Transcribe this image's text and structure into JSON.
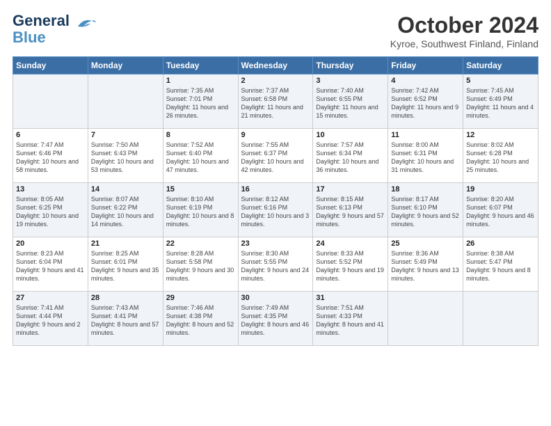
{
  "logo": {
    "line1": "General",
    "line2": "Blue"
  },
  "title": "October 2024",
  "location": "Kyroe, Southwest Finland, Finland",
  "weekdays": [
    "Sunday",
    "Monday",
    "Tuesday",
    "Wednesday",
    "Thursday",
    "Friday",
    "Saturday"
  ],
  "rows": [
    [
      {
        "day": "",
        "sunrise": "",
        "sunset": "",
        "daylight": ""
      },
      {
        "day": "",
        "sunrise": "",
        "sunset": "",
        "daylight": ""
      },
      {
        "day": "1",
        "sunrise": "Sunrise: 7:35 AM",
        "sunset": "Sunset: 7:01 PM",
        "daylight": "Daylight: 11 hours and 26 minutes."
      },
      {
        "day": "2",
        "sunrise": "Sunrise: 7:37 AM",
        "sunset": "Sunset: 6:58 PM",
        "daylight": "Daylight: 11 hours and 21 minutes."
      },
      {
        "day": "3",
        "sunrise": "Sunrise: 7:40 AM",
        "sunset": "Sunset: 6:55 PM",
        "daylight": "Daylight: 11 hours and 15 minutes."
      },
      {
        "day": "4",
        "sunrise": "Sunrise: 7:42 AM",
        "sunset": "Sunset: 6:52 PM",
        "daylight": "Daylight: 11 hours and 9 minutes."
      },
      {
        "day": "5",
        "sunrise": "Sunrise: 7:45 AM",
        "sunset": "Sunset: 6:49 PM",
        "daylight": "Daylight: 11 hours and 4 minutes."
      }
    ],
    [
      {
        "day": "6",
        "sunrise": "Sunrise: 7:47 AM",
        "sunset": "Sunset: 6:46 PM",
        "daylight": "Daylight: 10 hours and 58 minutes."
      },
      {
        "day": "7",
        "sunrise": "Sunrise: 7:50 AM",
        "sunset": "Sunset: 6:43 PM",
        "daylight": "Daylight: 10 hours and 53 minutes."
      },
      {
        "day": "8",
        "sunrise": "Sunrise: 7:52 AM",
        "sunset": "Sunset: 6:40 PM",
        "daylight": "Daylight: 10 hours and 47 minutes."
      },
      {
        "day": "9",
        "sunrise": "Sunrise: 7:55 AM",
        "sunset": "Sunset: 6:37 PM",
        "daylight": "Daylight: 10 hours and 42 minutes."
      },
      {
        "day": "10",
        "sunrise": "Sunrise: 7:57 AM",
        "sunset": "Sunset: 6:34 PM",
        "daylight": "Daylight: 10 hours and 36 minutes."
      },
      {
        "day": "11",
        "sunrise": "Sunrise: 8:00 AM",
        "sunset": "Sunset: 6:31 PM",
        "daylight": "Daylight: 10 hours and 31 minutes."
      },
      {
        "day": "12",
        "sunrise": "Sunrise: 8:02 AM",
        "sunset": "Sunset: 6:28 PM",
        "daylight": "Daylight: 10 hours and 25 minutes."
      }
    ],
    [
      {
        "day": "13",
        "sunrise": "Sunrise: 8:05 AM",
        "sunset": "Sunset: 6:25 PM",
        "daylight": "Daylight: 10 hours and 19 minutes."
      },
      {
        "day": "14",
        "sunrise": "Sunrise: 8:07 AM",
        "sunset": "Sunset: 6:22 PM",
        "daylight": "Daylight: 10 hours and 14 minutes."
      },
      {
        "day": "15",
        "sunrise": "Sunrise: 8:10 AM",
        "sunset": "Sunset: 6:19 PM",
        "daylight": "Daylight: 10 hours and 8 minutes."
      },
      {
        "day": "16",
        "sunrise": "Sunrise: 8:12 AM",
        "sunset": "Sunset: 6:16 PM",
        "daylight": "Daylight: 10 hours and 3 minutes."
      },
      {
        "day": "17",
        "sunrise": "Sunrise: 8:15 AM",
        "sunset": "Sunset: 6:13 PM",
        "daylight": "Daylight: 9 hours and 57 minutes."
      },
      {
        "day": "18",
        "sunrise": "Sunrise: 8:17 AM",
        "sunset": "Sunset: 6:10 PM",
        "daylight": "Daylight: 9 hours and 52 minutes."
      },
      {
        "day": "19",
        "sunrise": "Sunrise: 8:20 AM",
        "sunset": "Sunset: 6:07 PM",
        "daylight": "Daylight: 9 hours and 46 minutes."
      }
    ],
    [
      {
        "day": "20",
        "sunrise": "Sunrise: 8:23 AM",
        "sunset": "Sunset: 6:04 PM",
        "daylight": "Daylight: 9 hours and 41 minutes."
      },
      {
        "day": "21",
        "sunrise": "Sunrise: 8:25 AM",
        "sunset": "Sunset: 6:01 PM",
        "daylight": "Daylight: 9 hours and 35 minutes."
      },
      {
        "day": "22",
        "sunrise": "Sunrise: 8:28 AM",
        "sunset": "Sunset: 5:58 PM",
        "daylight": "Daylight: 9 hours and 30 minutes."
      },
      {
        "day": "23",
        "sunrise": "Sunrise: 8:30 AM",
        "sunset": "Sunset: 5:55 PM",
        "daylight": "Daylight: 9 hours and 24 minutes."
      },
      {
        "day": "24",
        "sunrise": "Sunrise: 8:33 AM",
        "sunset": "Sunset: 5:52 PM",
        "daylight": "Daylight: 9 hours and 19 minutes."
      },
      {
        "day": "25",
        "sunrise": "Sunrise: 8:36 AM",
        "sunset": "Sunset: 5:49 PM",
        "daylight": "Daylight: 9 hours and 13 minutes."
      },
      {
        "day": "26",
        "sunrise": "Sunrise: 8:38 AM",
        "sunset": "Sunset: 5:47 PM",
        "daylight": "Daylight: 9 hours and 8 minutes."
      }
    ],
    [
      {
        "day": "27",
        "sunrise": "Sunrise: 7:41 AM",
        "sunset": "Sunset: 4:44 PM",
        "daylight": "Daylight: 9 hours and 2 minutes."
      },
      {
        "day": "28",
        "sunrise": "Sunrise: 7:43 AM",
        "sunset": "Sunset: 4:41 PM",
        "daylight": "Daylight: 8 hours and 57 minutes."
      },
      {
        "day": "29",
        "sunrise": "Sunrise: 7:46 AM",
        "sunset": "Sunset: 4:38 PM",
        "daylight": "Daylight: 8 hours and 52 minutes."
      },
      {
        "day": "30",
        "sunrise": "Sunrise: 7:49 AM",
        "sunset": "Sunset: 4:35 PM",
        "daylight": "Daylight: 8 hours and 46 minutes."
      },
      {
        "day": "31",
        "sunrise": "Sunrise: 7:51 AM",
        "sunset": "Sunset: 4:33 PM",
        "daylight": "Daylight: 8 hours and 41 minutes."
      },
      {
        "day": "",
        "sunrise": "",
        "sunset": "",
        "daylight": ""
      },
      {
        "day": "",
        "sunrise": "",
        "sunset": "",
        "daylight": ""
      }
    ]
  ]
}
